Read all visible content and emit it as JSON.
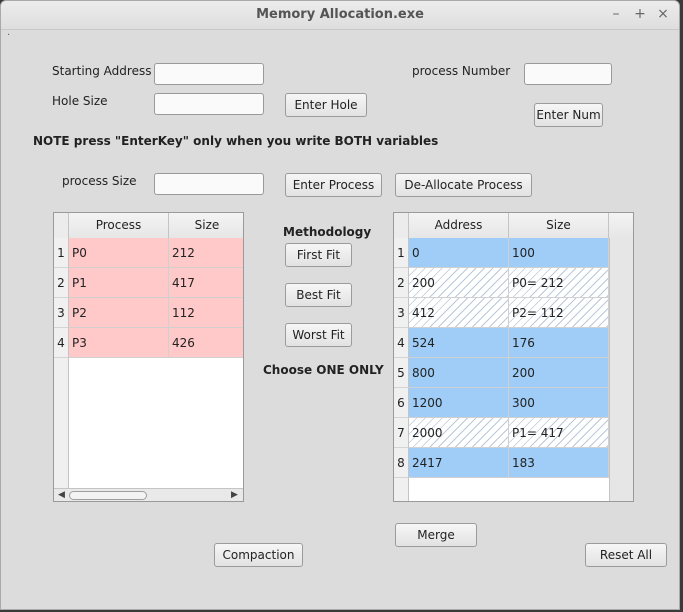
{
  "window": {
    "title": "Memory Allocation.exe",
    "minimize": "–",
    "maximize": "+",
    "close": "×",
    "menu_glyph": "."
  },
  "hole": {
    "start_label": "Starting Address",
    "size_label": "Hole Size",
    "start_value": "",
    "size_value": "",
    "enter_button": "Enter Hole"
  },
  "process_number": {
    "label": "process Number",
    "value": "",
    "enter_button": "Enter Num"
  },
  "note": "NOTE press \"EnterKey\" only when you write BOTH variables",
  "process": {
    "size_label": "process Size",
    "size_value": "",
    "enter_button": "Enter Process",
    "deallocate_button": "De-Allocate Process"
  },
  "process_table": {
    "headers": [
      "Process",
      "Size"
    ],
    "rows": [
      {
        "num": "1",
        "process": "P0",
        "size": "212"
      },
      {
        "num": "2",
        "process": "P1",
        "size": "417"
      },
      {
        "num": "3",
        "process": "P2",
        "size": "112"
      },
      {
        "num": "4",
        "process": "P3",
        "size": "426"
      }
    ],
    "row_color": "#ffc9c9"
  },
  "methodology": {
    "title": "Methodology",
    "first_fit": "First Fit",
    "best_fit": "Best Fit",
    "worst_fit": "Worst Fit",
    "note": "Choose ONE ONLY"
  },
  "memory_table": {
    "headers": [
      "Address",
      "Size"
    ],
    "rows": [
      {
        "num": "1",
        "address": "0",
        "size": "100",
        "type": "hole"
      },
      {
        "num": "2",
        "address": "200",
        "size": "P0= 212",
        "type": "allocated"
      },
      {
        "num": "3",
        "address": "412",
        "size": "P2= 112",
        "type": "allocated"
      },
      {
        "num": "4",
        "address": "524",
        "size": "176",
        "type": "hole"
      },
      {
        "num": "5",
        "address": "800",
        "size": "200",
        "type": "hole"
      },
      {
        "num": "6",
        "address": "1200",
        "size": "300",
        "type": "hole"
      },
      {
        "num": "7",
        "address": "2000",
        "size": "P1= 417",
        "type": "allocated"
      },
      {
        "num": "8",
        "address": "2417",
        "size": "183",
        "type": "hole"
      }
    ],
    "hole_color": "#9fcdf7"
  },
  "actions": {
    "merge": "Merge",
    "compaction": "Compaction",
    "reset_all": "Reset All"
  }
}
